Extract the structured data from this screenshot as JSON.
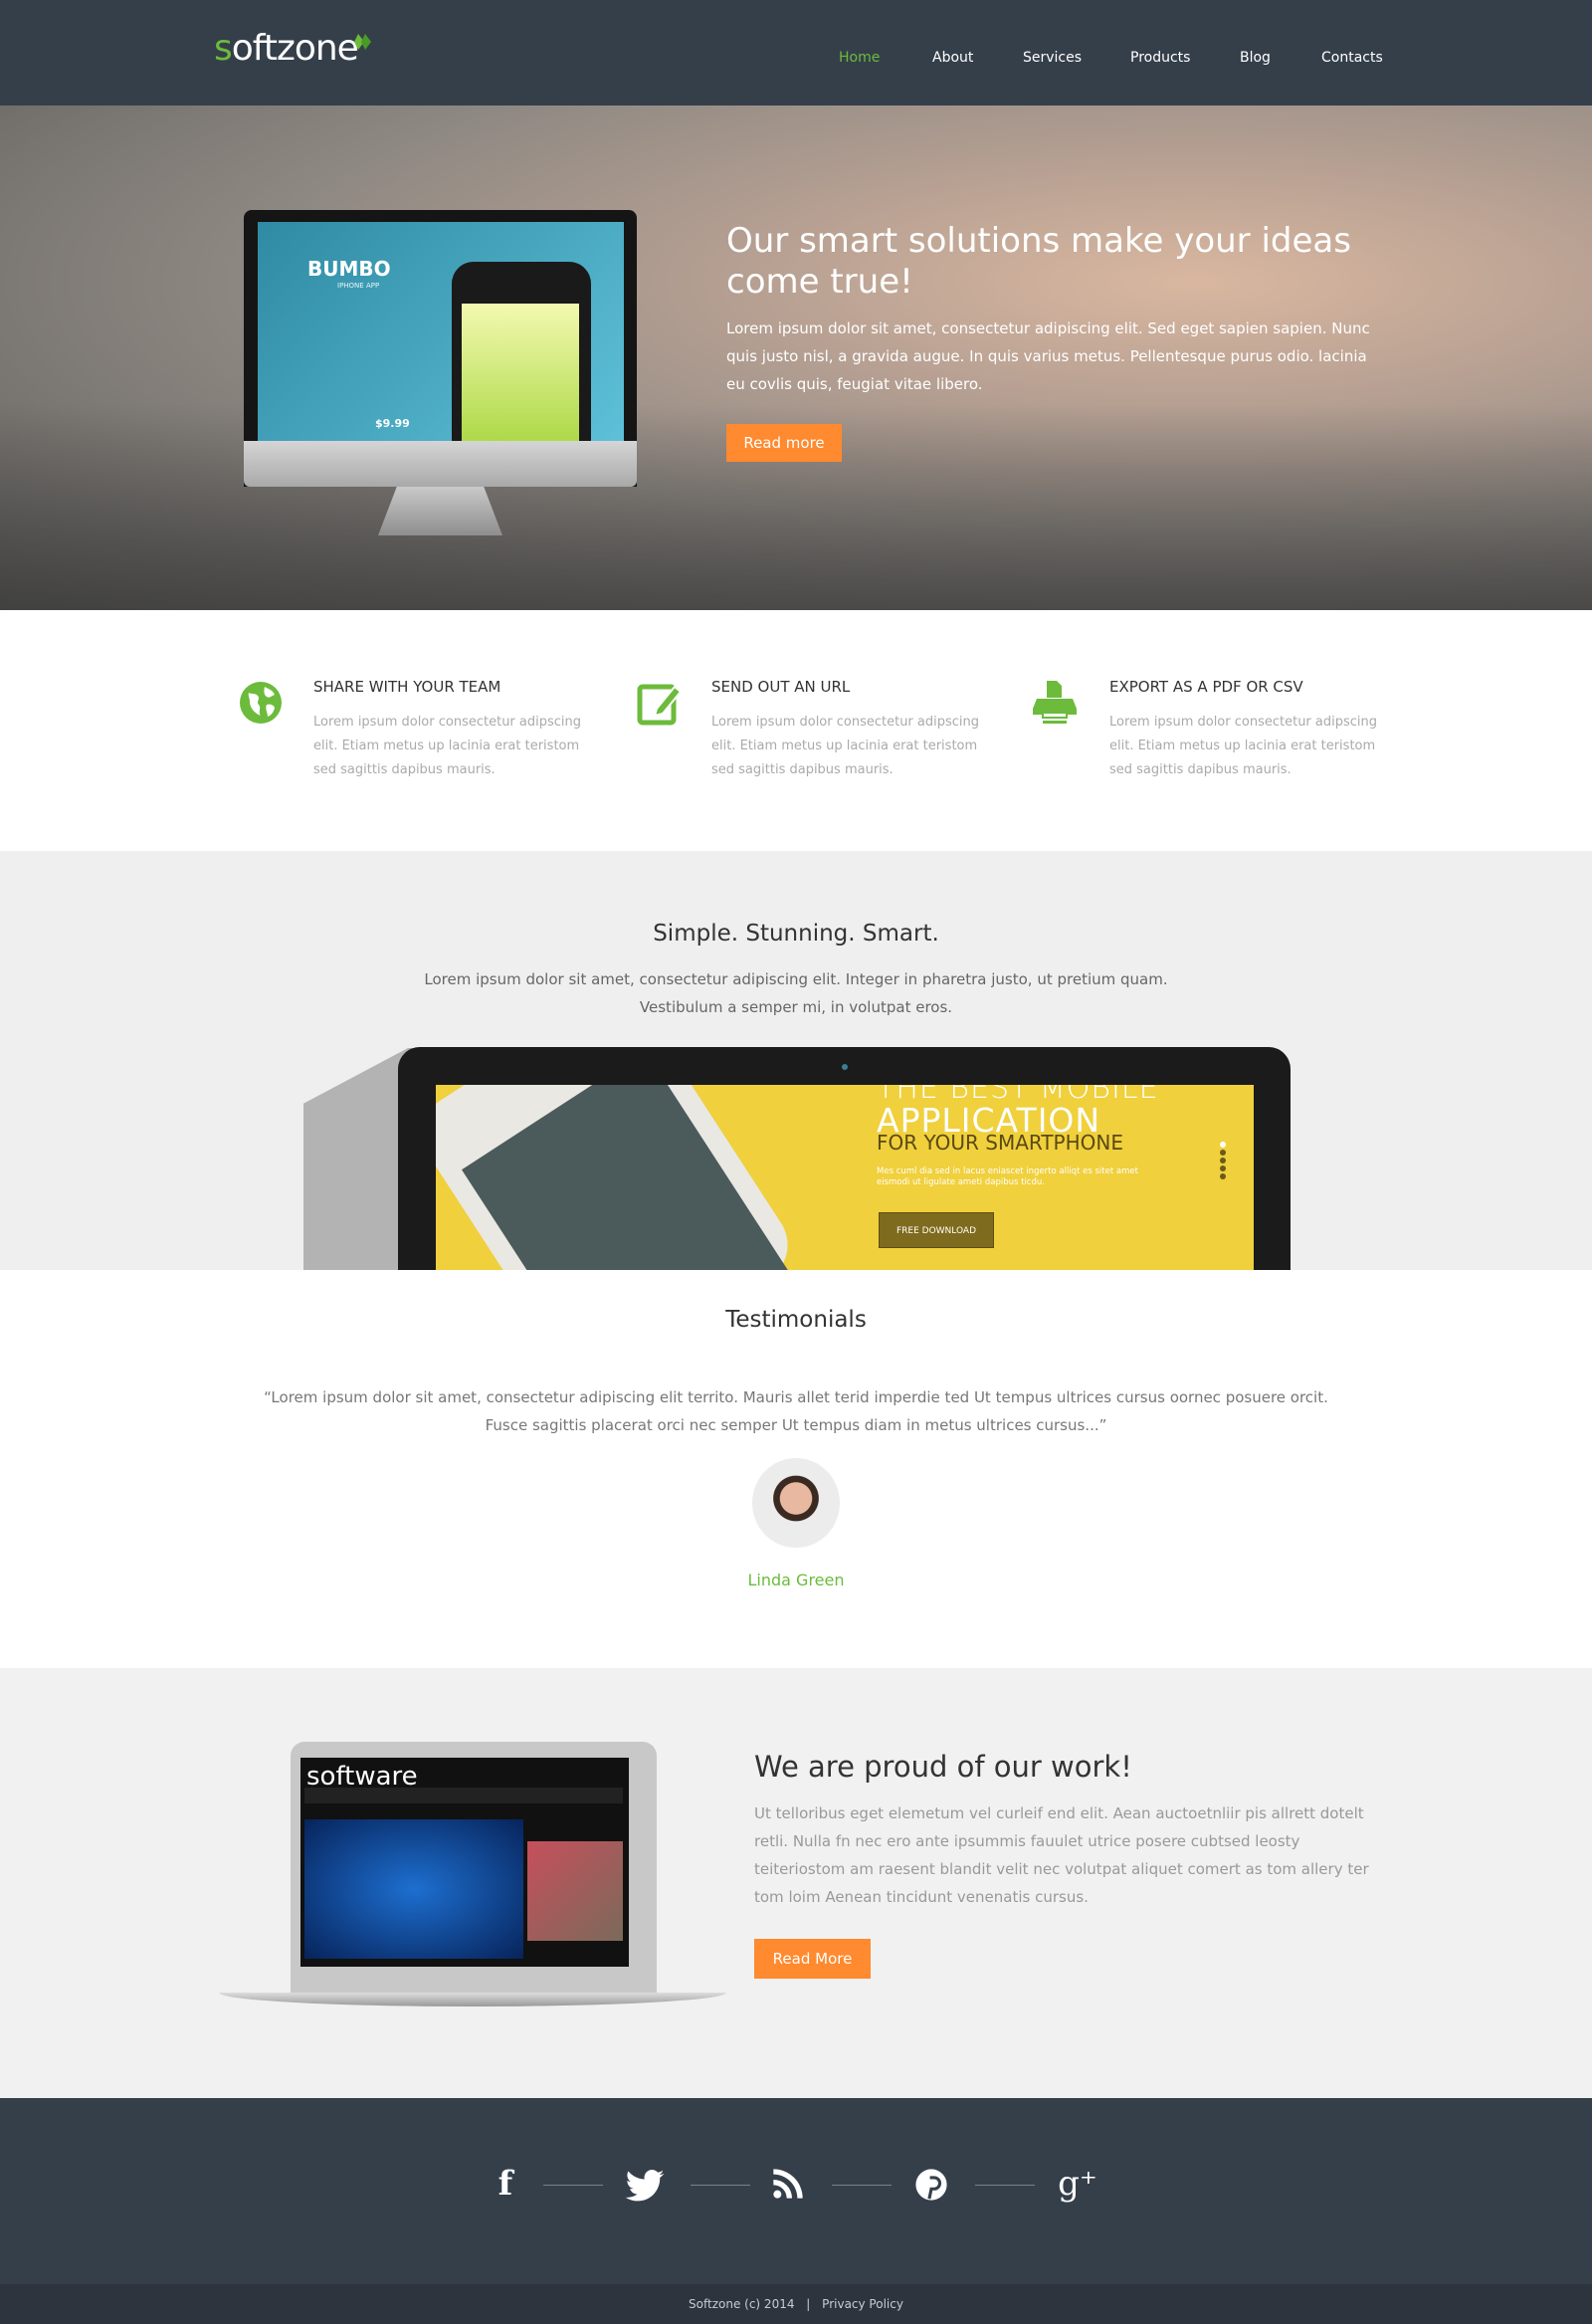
{
  "header": {
    "logo": "softzone",
    "logo_first": "s",
    "logo_rest": "oftzone",
    "nav": [
      {
        "label": "Home",
        "active": true
      },
      {
        "label": "About"
      },
      {
        "label": "Services"
      },
      {
        "label": "Products"
      },
      {
        "label": "Blog"
      },
      {
        "label": "Contacts"
      }
    ]
  },
  "hero": {
    "title": "Our smart solutions make your ideas come true!",
    "text": "Lorem ipsum dolor sit amet, consectetur adipiscing elit. Sed eget sapien sapien. Nunc quis justo nisl, a gravida augue. In quis varius metus. Pellentesque purus odio. lacinia eu covlis quis, feugiat vitae libero.",
    "button": "Read more",
    "mockup": {
      "app_name": "BUMBO",
      "app_sub": "IPHONE APP",
      "price": "$9.99"
    }
  },
  "features": [
    {
      "icon": "globe-icon",
      "title": "SHARE WITH YOUR TEAM",
      "text": "Lorem ipsum dolor consectetur adipscing elit. Etiam metus up lacinia erat teristom sed sagittis dapibus mauris."
    },
    {
      "icon": "edit-icon",
      "title": "SEND OUT AN URL",
      "text": "Lorem ipsum dolor consectetur adipscing elit. Etiam metus up lacinia erat teristom sed sagittis dapibus mauris."
    },
    {
      "icon": "printer-icon",
      "title": "EXPORT AS A PDF OR CSV",
      "text": "Lorem ipsum dolor consectetur adipscing elit. Etiam metus up lacinia erat teristom sed sagittis dapibus mauris."
    }
  ],
  "simple": {
    "title": "Simple. Stunning. Smart.",
    "text": "Lorem ipsum dolor sit amet, consectetur adipiscing elit. Integer in pharetra justo, ut pretium quam. Vestibulum a semper mi, in volutpat eros.",
    "screen": {
      "line1": "THE BEST MOBILE",
      "line2": "APPLICATION",
      "line3": "FOR YOUR SMARTPHONE",
      "line4": "Mes cuml dia sed in lacus eniascet ingerto alliqt es sitet amet eismodi ut ligulate ameti dapibus ticdu.",
      "button": "FREE DOWNLOAD"
    }
  },
  "testimonials": {
    "title": "Testimonials",
    "quote": "“Lorem ipsum dolor sit amet, consectetur adipiscing elit territo. Mauris  allet terid imperdie ted  Ut tempus ultrices cursus oornec posuere orcit. Fusce sagittis placerat orci nec semper Ut tempus diam in metus ultrices cursus...”",
    "name": "Linda Green"
  },
  "proud": {
    "title": "We are proud of our work!",
    "text": "Ut telloribus eget elemetum vel curleif end elit. Aean auctoetnliir pis allrett dotelt retli. Nulla fn nec ero ante ipsummis  fauulet utrice posere cubtsed leosty teiteriostom am raesent blandit velit nec volutpat aliquet comert as tom allery ter tom loim Aenean tincidunt venenatis cursus.",
    "button": "Read More",
    "mockup": {
      "brand": "software"
    }
  },
  "footer": {
    "social": [
      {
        "icon": "facebook-icon",
        "glyph": "f"
      },
      {
        "icon": "twitter-icon",
        "glyph": "🐦"
      },
      {
        "icon": "rss-icon",
        "glyph": "◔"
      },
      {
        "icon": "pinterest-icon",
        "glyph": "℗"
      },
      {
        "icon": "google-plus-icon",
        "glyph": "g⁺"
      }
    ],
    "copyright": "Softzone (c) 2014",
    "separator": "|",
    "privacy": "Privacy Policy"
  },
  "colors": {
    "accent": "#6cbb3c",
    "button": "#ff8a2f",
    "header": "#353f4a",
    "footer_bottom": "#2d343d"
  }
}
